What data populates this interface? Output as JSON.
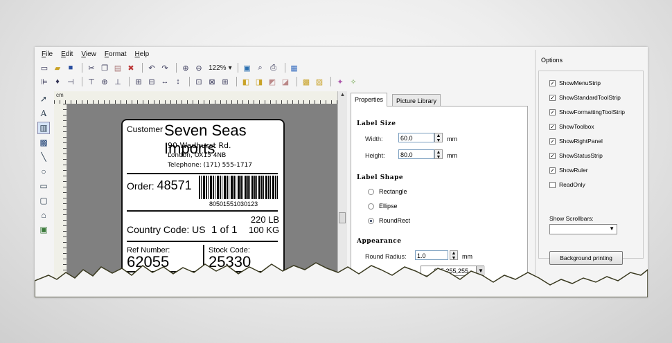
{
  "menu": [
    "File",
    "Edit",
    "View",
    "Format",
    "Help"
  ],
  "toolbar": {
    "zoom_value": "122%",
    "zoom_caret": "▾"
  },
  "ruler": {
    "unit": "cm"
  },
  "label": {
    "customer_key": "Customer",
    "customer_name": "Seven Seas Imports",
    "address1": "90 Wadhurst Rd.",
    "address2": "London, OX15 4NB",
    "telephone": "Telephone: (171) 555-1717",
    "order_label": "Order:",
    "order_number": "48571",
    "barcode_number": "80501551030123",
    "country_code": "Country Code: US",
    "pieces": "1 of 1",
    "weight_lb": "220 LB",
    "weight_kg": "100 KG",
    "ref_label": "Ref Number:",
    "ref_value": "62055",
    "stock_label": "Stock Code:",
    "stock_value": "25330"
  },
  "properties": {
    "tabs": [
      "Properties",
      "Picture Library"
    ],
    "label_size_title": "Label Size",
    "width_label": "Width:",
    "width_value": "60.0",
    "height_label": "Height:",
    "height_value": "80.0",
    "unit": "mm",
    "label_shape_title": "Label Shape",
    "shapes": [
      "Rectangle",
      "Ellipse",
      "RoundRect"
    ],
    "selected_shape": "RoundRect",
    "appearance_title": "Appearance",
    "round_radius_label": "Round Radius:",
    "round_radius_value": "1.0",
    "color_value": "255,255,255"
  },
  "options": {
    "title": "Options",
    "checkboxes": [
      {
        "label": "ShowMenuStrip",
        "checked": true
      },
      {
        "label": "ShowStandardToolStrip",
        "checked": true
      },
      {
        "label": "ShowFormattingToolStrip",
        "checked": true
      },
      {
        "label": "ShowToolbox",
        "checked": true
      },
      {
        "label": "ShowRightPanel",
        "checked": true
      },
      {
        "label": "ShowStatusStrip",
        "checked": true
      },
      {
        "label": "ShowRuler",
        "checked": true
      },
      {
        "label": "ReadOnly",
        "checked": false
      }
    ],
    "scrollbars_label": "Show Scrollbars:",
    "scrollbars_value": "",
    "background_printing_button": "Background printing"
  },
  "colors": {
    "canvas": "#808080",
    "window": "#f4f4f4",
    "torn_edge": "#3a3a20"
  }
}
